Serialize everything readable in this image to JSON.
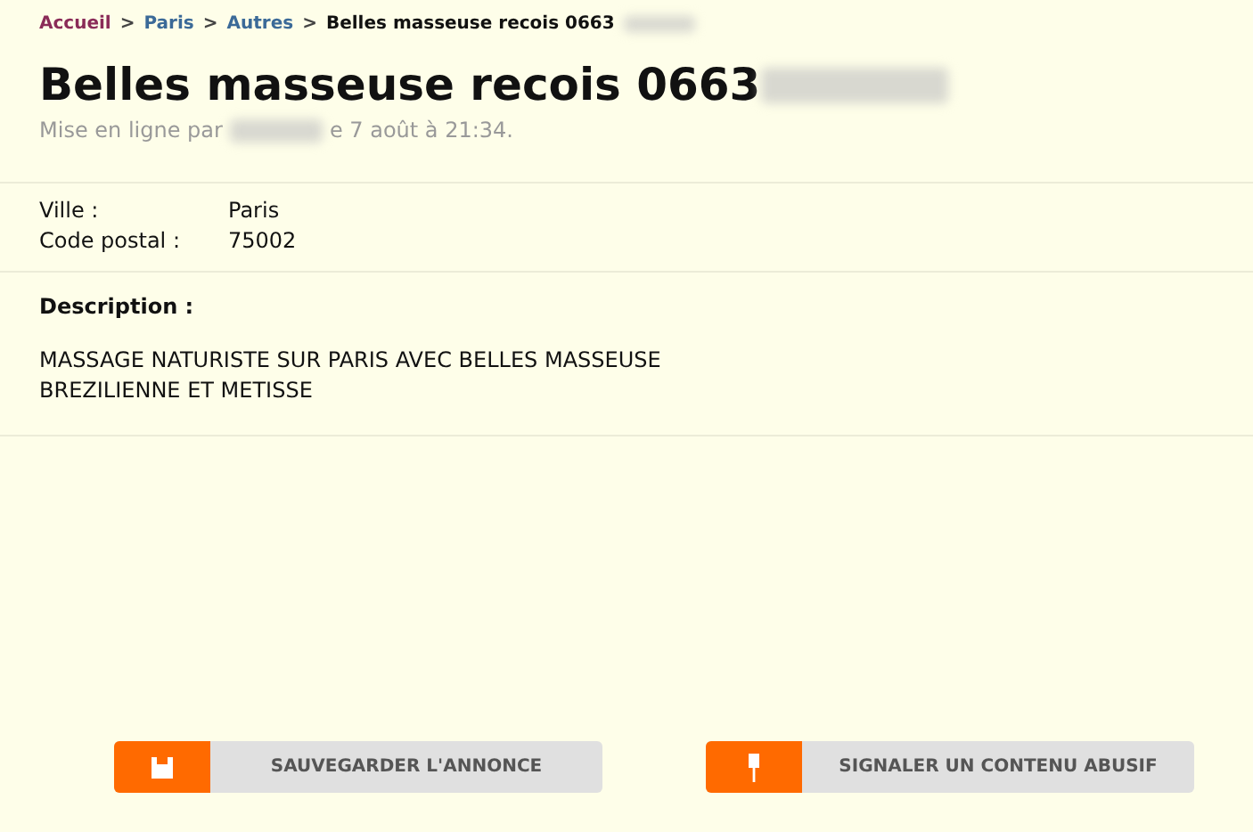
{
  "breadcrumb": [
    {
      "label": "Accueil",
      "kind": "home"
    },
    {
      "label": "Paris",
      "kind": "link"
    },
    {
      "label": "Autres",
      "kind": "link"
    },
    {
      "label": "Belles masseuse recois 0663",
      "kind": "current"
    }
  ],
  "separator": ">",
  "title": "Belles masseuse recois 0663",
  "meta": {
    "before": "Mise en ligne par",
    "after": "e 7 août à 21:34."
  },
  "details": [
    {
      "label": "Ville :",
      "value": "Paris"
    },
    {
      "label": "Code postal :",
      "value": "75002"
    }
  ],
  "description": {
    "heading": "Description :",
    "lines": [
      "MASSAGE NATURISTE SUR PARIS AVEC BELLES MASSEUSE",
      "BREZILIENNE ET METISSE"
    ]
  },
  "buttons": [
    {
      "label": "SAUVEGARDER L'ANNONCE",
      "kind": "save"
    },
    {
      "label": "SIGNALER UN CONTENU ABUSIF",
      "kind": "report"
    }
  ]
}
